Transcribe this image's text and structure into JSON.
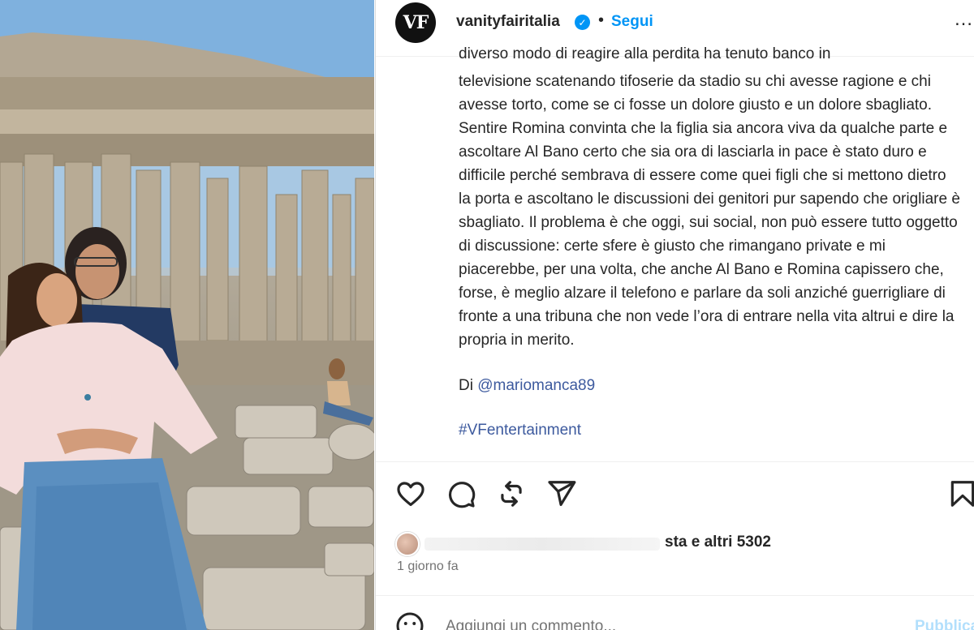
{
  "post": {
    "username": "vanityfairitalia",
    "avatar_text": "VF",
    "verified_mark": "✓",
    "separator": "•",
    "follow_label": "Segui",
    "more_label": "…"
  },
  "caption": {
    "cut_line": "diverso modo di reagire alla perdita ha tenuto banco in",
    "body": "televisione scatenando tifoserie da stadio su chi avesse ragione e chi avesse torto, come se ci fosse un dolore giusto e un dolore sbagliato. Sentire Romina convinta che la figlia sia ancora viva da qualche parte e ascoltare Al Bano certo che sia ora di lasciarla in pace è stato duro e difficile perché sembrava di essere come quei figli che si mettono dietro la porta e ascoltano le discussioni dei genitori pur sapendo che origliare è sbagliato. Il problema è che oggi, sui social, non può essere tutto oggetto di discussione: certe sfere è giusto che rimangano private e mi piacerebbe, per una volta, che anche Al Bano e Romina capissero che, forse, è meglio alzare il telefono e parlare da soli anziché guerrigliare di fronte a una tribuna che non vede l’ora di entrare nella vita altrui e dire la propria in merito.",
    "byline_prefix": "Di ",
    "byline_handle": "@mariomanca89",
    "hashtag": "#VFentertainment"
  },
  "actions": {
    "like_icon": "heart-icon",
    "comment_icon": "comment-icon",
    "repost_icon": "repost-icon",
    "share_icon": "send-icon",
    "save_icon": "bookmark-icon"
  },
  "likes": {
    "text": "sta e altri 5302"
  },
  "timestamp": "1 giorno fa",
  "comment": {
    "placeholder": "Aggiungi un commento...",
    "publish_label": "Pubblica"
  },
  "colors": {
    "accent": "#0095f6",
    "link": "#3d5a9e",
    "muted": "#737373"
  }
}
